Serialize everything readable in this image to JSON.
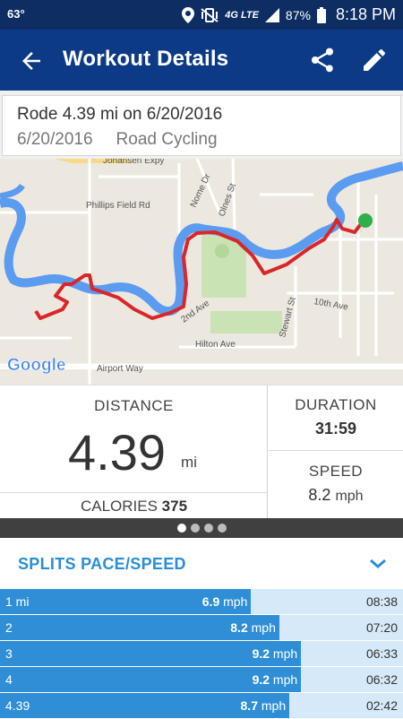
{
  "status_bar": {
    "temperature": "63°",
    "battery": "87%",
    "time": "8:18 PM",
    "network": "4G LTE"
  },
  "app_bar": {
    "title": "Workout Details",
    "back_icon": "arrow-back-icon",
    "share_icon": "share-icon",
    "edit_icon": "pencil-icon"
  },
  "workout": {
    "title": "Rode 4.39 mi on 6/20/2016",
    "date": "6/20/2016",
    "activity": "Road Cycling"
  },
  "map": {
    "labels": {
      "johansen": "Johansen Expy",
      "phillips": "Phillips Field Rd",
      "nome": "Nome Dr",
      "olnes": "Olnes St",
      "second_ave": "2nd Ave",
      "tenth_ave": "10th Ave",
      "stewart": "Stewart St",
      "hilton": "Hilton Ave",
      "airport": "Airport Way"
    },
    "google_logo": "Google",
    "route_color": "#d9262b",
    "river_color": "#5b9bf0"
  },
  "stats": {
    "distance_label": "DISTANCE",
    "distance_value": "4.39",
    "distance_unit": "mi",
    "calories_label": "CALORIES",
    "calories_value": "375",
    "duration_label": "DURATION",
    "duration_value": "31:59",
    "speed_label": "SPEED",
    "speed_value": "8.2",
    "speed_unit": "mph"
  },
  "pager": {
    "count": 4,
    "active": 0
  },
  "splits": {
    "title": "SPLITS PACE/SPEED",
    "unit": "mph",
    "max_speed": 9.2,
    "rows": [
      {
        "label": "1 mi",
        "speed": "6.9",
        "time": "08:38",
        "fraction": 0.623
      },
      {
        "label": "2",
        "speed": "8.2",
        "time": "07:20",
        "fraction": 0.693
      },
      {
        "label": "3",
        "speed": "9.2",
        "time": "06:33",
        "fraction": 0.747
      },
      {
        "label": "4",
        "speed": "9.2",
        "time": "06:32",
        "fraction": 0.747
      },
      {
        "label": "4.39",
        "speed": "8.7",
        "time": "02:42",
        "fraction": 0.718
      }
    ]
  }
}
